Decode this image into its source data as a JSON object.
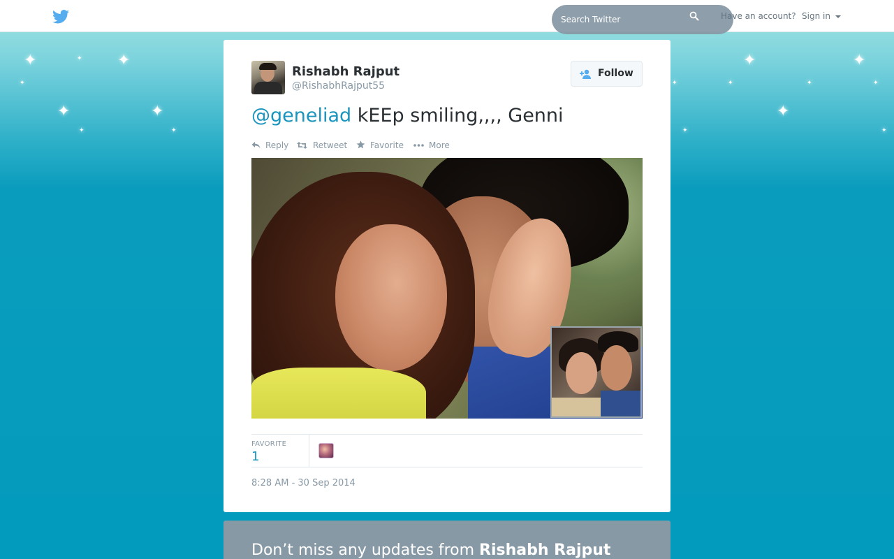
{
  "topbar": {
    "search_placeholder": "Search Twitter",
    "account_prompt": "Have an account?",
    "signin_label": "Sign in"
  },
  "tweet": {
    "author_fullname": "Rishabh Rajput",
    "author_username": "@RishabhRajput55",
    "follow_label": "Follow",
    "mention": "@geneliad",
    "text": " kEEp smiling,,,, Genni",
    "actions": {
      "reply": "Reply",
      "retweet": "Retweet",
      "favorite": "Favorite",
      "more": "More"
    },
    "stats": {
      "favorite_label": "FAVORITE",
      "favorite_count": "1"
    },
    "timestamp": "8:28 AM - 30 Sep 2014"
  },
  "banner": {
    "prefix": "Don’t miss any updates from ",
    "name": "Rishabh Rajput"
  },
  "colors": {
    "link": "#1b95be",
    "muted": "#8899a6",
    "text": "#292f33",
    "background_teal": "#029bbd",
    "twitter_blue": "#55acee"
  },
  "icons": {
    "logo": "twitter-bird-icon",
    "search": "search-icon",
    "follow": "person-add-icon",
    "reply": "reply-icon",
    "retweet": "retweet-icon",
    "favorite": "star-icon",
    "more": "ellipsis-icon"
  }
}
